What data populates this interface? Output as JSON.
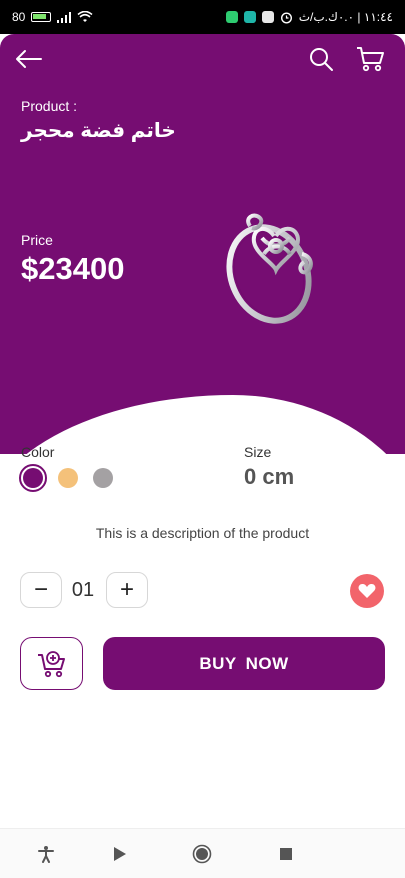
{
  "status_bar": {
    "battery_level": "80",
    "time": "١١:٤٤ | ٠.٠ك.ب/ث"
  },
  "header": {
    "back_icon": "arrow-left-icon",
    "search_icon": "search-icon",
    "cart_icon": "shopping-cart-icon"
  },
  "product": {
    "label": "Product :",
    "name": "خاتم فضة محجر",
    "price_label": "Price",
    "price": "$23400",
    "description": "This is a description of the product"
  },
  "options": {
    "color_label": "Color",
    "colors": [
      "#760d72",
      "#f4c17a",
      "#a4a1a3"
    ],
    "selected_color_index": 0,
    "size_label": "Size",
    "size_value": "0 cm"
  },
  "quantity": {
    "minus_label": "−",
    "value": "01",
    "plus_label": "+"
  },
  "actions": {
    "buy_label": "BUY  NOW",
    "add_to_cart_icon": "add-to-cart-icon",
    "favorite_icon": "heart-icon"
  },
  "navigation": {
    "items": [
      "accessibility-icon",
      "play-icon",
      "record-icon",
      "stop-icon"
    ]
  },
  "theme": {
    "primary": "#760d72",
    "favorite": "#f2646b"
  }
}
